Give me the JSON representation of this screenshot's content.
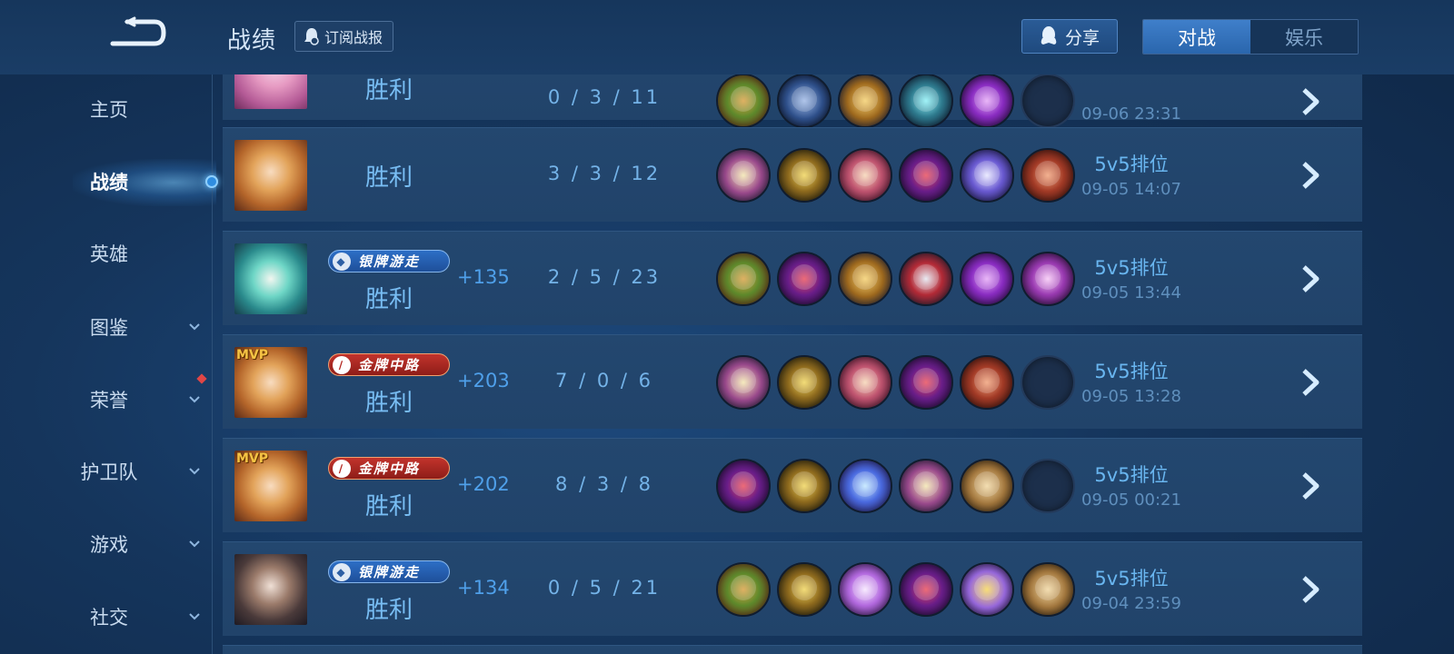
{
  "header": {
    "title": "战绩",
    "subscribe_label": "订阅战报",
    "share_label": "分享",
    "tabs": [
      {
        "label": "对战",
        "active": true
      },
      {
        "label": "娱乐",
        "active": false
      }
    ]
  },
  "sidebar": {
    "items": [
      {
        "label": "主页",
        "has_chevron": false,
        "active": false
      },
      {
        "label": "战绩",
        "has_chevron": false,
        "active": true
      },
      {
        "label": "英雄",
        "has_chevron": false,
        "active": false
      },
      {
        "label": "图鉴",
        "has_chevron": true,
        "active": false
      },
      {
        "label": "荣誉",
        "has_chevron": true,
        "active": false,
        "notification": true
      },
      {
        "label": "护卫队",
        "has_chevron": true,
        "active": false
      },
      {
        "label": "游戏",
        "has_chevron": true,
        "active": false
      },
      {
        "label": "社交",
        "has_chevron": true,
        "active": false
      }
    ]
  },
  "colors": {
    "accent": "#3f7fca",
    "result_text": "#78bdf3",
    "points_text": "#4fa0ea",
    "silver_badge": "#2d6fc6",
    "gold_badge": "#c2342c"
  },
  "matches": [
    {
      "hero_icon": "hero-pink-haired-avatar",
      "mvp": false,
      "badge": null,
      "result": "胜利",
      "points": "",
      "kda": "0 / 3 / 11",
      "items": [
        "green-amulet-item",
        "blue-boots-item",
        "golden-chalice-item",
        "teal-blade-item",
        "purple-scythe-item",
        "empty"
      ],
      "mode": "",
      "date": "09-06  23:31",
      "partially_visible": true
    },
    {
      "hero_icon": "hero-golden-haired-mage-avatar",
      "mvp": false,
      "badge": null,
      "result": "胜利",
      "points": "",
      "kda": "3 / 3 / 12",
      "items": [
        "spellbook-item",
        "golden-boots-item",
        "red-tome-item",
        "purple-hat-item",
        "purple-staff-item",
        "red-book-item"
      ],
      "mode": "5v5排位",
      "date": "09-05  14:07"
    },
    {
      "hero_icon": "hero-teal-haired-support-avatar",
      "mvp": false,
      "badge": {
        "label": "银牌游走",
        "tier": "silver"
      },
      "result": "胜利",
      "points": "+135",
      "kda": "2 / 5 / 23",
      "items": [
        "green-amulet-item",
        "purple-hat-item",
        "golden-chalice-item",
        "red-gauntlet-item",
        "purple-scythe-item",
        "purple-ring-item"
      ],
      "mode": "5v5排位",
      "date": "09-05  13:44"
    },
    {
      "hero_icon": "hero-golden-haired-mage-avatar",
      "mvp": true,
      "mvp_label": "MVP",
      "badge": {
        "label": "金牌中路",
        "tier": "gold"
      },
      "result": "胜利",
      "points": "+203",
      "kda": "7 / 0 / 6",
      "items": [
        "spellbook-item",
        "golden-boots-item",
        "red-tome-item",
        "purple-hat-item",
        "red-book-item",
        "empty"
      ],
      "mode": "5v5排位",
      "date": "09-05  13:28"
    },
    {
      "hero_icon": "hero-golden-haired-mage-avatar",
      "mvp": true,
      "mvp_label": "MVP",
      "badge": {
        "label": "金牌中路",
        "tier": "gold"
      },
      "result": "胜利",
      "points": "+202",
      "kda": "8 / 3 / 8",
      "items": [
        "purple-hat-item",
        "golden-boots-item",
        "blue-scepter-item",
        "spellbook-item",
        "wooden-shield-item",
        "empty"
      ],
      "mode": "5v5排位",
      "date": "09-05  00:21"
    },
    {
      "hero_icon": "hero-dark-haired-support-avatar",
      "mvp": false,
      "badge": {
        "label": "银牌游走",
        "tier": "silver"
      },
      "result": "胜利",
      "points": "+134",
      "kda": "0 / 5 / 21",
      "items": [
        "green-amulet-item",
        "golden-boots-item",
        "violet-cloak-item",
        "purple-hat-item",
        "golden-staff-item",
        "wooden-shield-item"
      ],
      "mode": "5v5排位",
      "date": "09-04  23:59"
    }
  ]
}
